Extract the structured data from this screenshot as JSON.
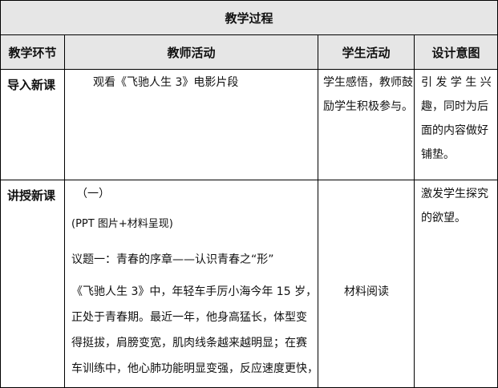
{
  "table": {
    "title": "教学过程",
    "headers": [
      "教学环节",
      "教师活动",
      "学生活动",
      "设计意图"
    ],
    "rows": [
      {
        "stage": "导入新课",
        "teacher": [
          "观看《飞驰人生 3》电影片段"
        ],
        "student": [
          "学生感悟，教师鼓",
          "励学生积极参与。"
        ],
        "intent": [
          "引 发 学 生 兴",
          "趣，同时为后",
          "面的内容做好",
          "铺垫。"
        ]
      },
      {
        "stage": "讲授新课",
        "teacher": [
          "（一）",
          "(PPT 图片+材料呈现)",
          "议题一：青春的序章——认识青春之“形”",
          "《飞驰人生 3》中，年轻车手厉小海今年 15 岁，",
          "正处于青春期。最近一年，他身高猛长，体型变",
          "得挺拔，肩膀变宽，肌肉线条越来越明显；在赛",
          "车训练中，他心肺功能明显变强，反应速度更快，"
        ],
        "student": [
          "材料阅读"
        ],
        "intent": [
          "激发学生探究",
          "的欲望。"
        ]
      }
    ]
  }
}
